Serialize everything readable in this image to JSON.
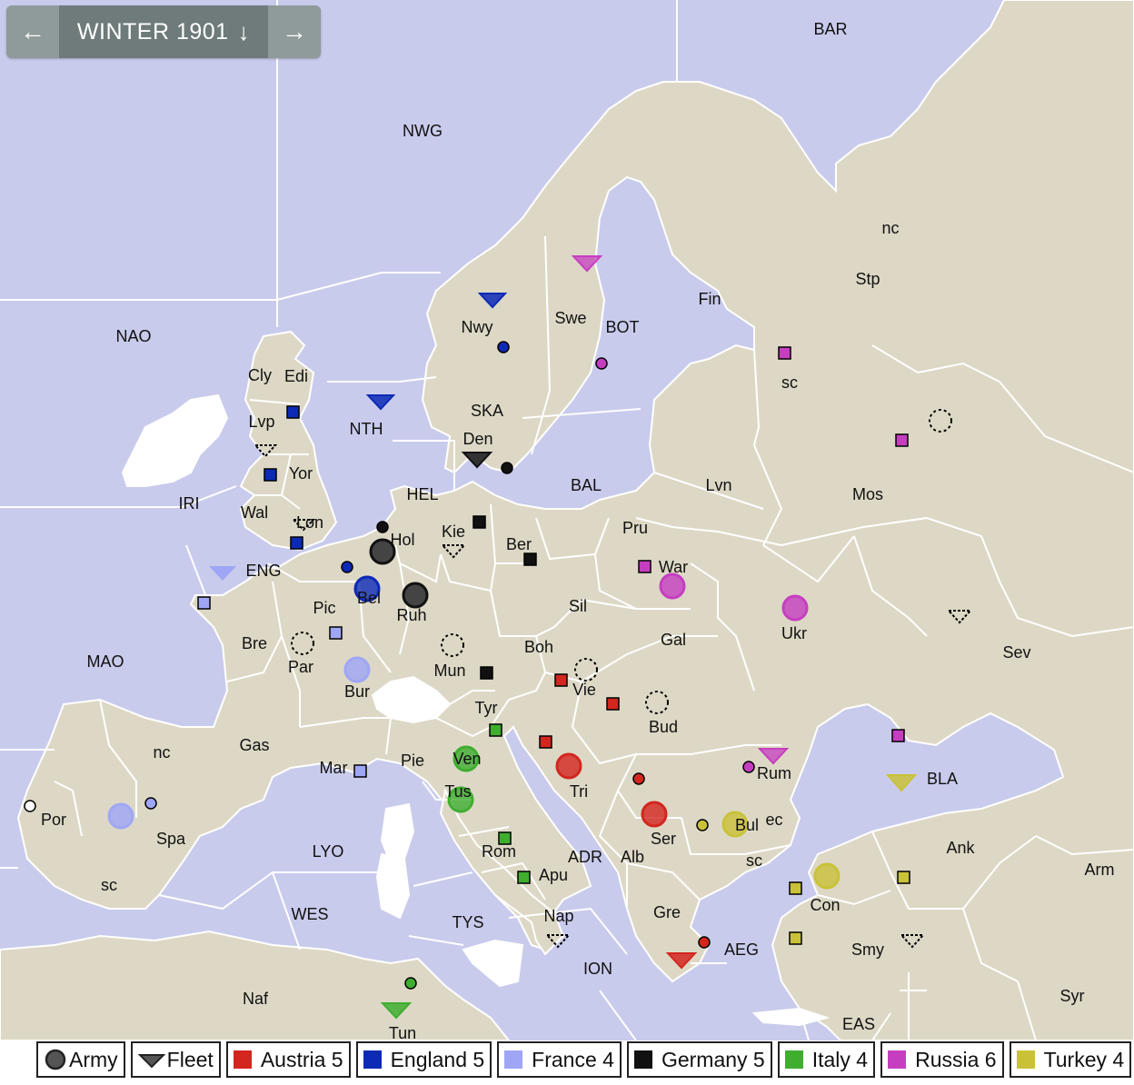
{
  "nav": {
    "prev_icon": "←",
    "phase_label": "WINTER 1901",
    "phase_icon": "↓",
    "next_icon": "→"
  },
  "colors": {
    "sea": "#c9cbec",
    "land": "#ddd8c5",
    "border": "#ffffff",
    "neutral": "#ffffff",
    "Austria": "#d3261f",
    "England": "#0c2ab6",
    "France": "#9fa6f5",
    "Germany": "#111111",
    "Italy": "#3fae2f",
    "Russia": "#c63ec0",
    "Turkey": "#c9c239"
  },
  "legend": [
    {
      "label": "Army",
      "icon": "army-icon"
    },
    {
      "label": "Fleet",
      "icon": "fleet-icon"
    },
    {
      "label": "Austria 5",
      "power": "Austria"
    },
    {
      "label": "England 5",
      "power": "England"
    },
    {
      "label": "France 4",
      "power": "France"
    },
    {
      "label": "Germany 5",
      "power": "Germany"
    },
    {
      "label": "Italy 4",
      "power": "Italy"
    },
    {
      "label": "Russia 6",
      "power": "Russia"
    },
    {
      "label": "Turkey 4",
      "power": "Turkey"
    }
  ],
  "provinces": [
    "BAR",
    "NWG",
    "NAO",
    "Cly",
    "Edi",
    "Lvp",
    "Yor",
    "Wal",
    "Lon",
    "IRI",
    "ENG",
    "MAO",
    "Bre",
    "Pic",
    "Par",
    "Bur",
    "Gas",
    "Mar",
    "nc",
    "sc",
    "Por",
    "Spa",
    "LYO",
    "WES",
    "Naf",
    "Tun",
    "NTH",
    "HEL",
    "SKA",
    "Den",
    "Nwy",
    "Swe",
    "BOT",
    "Fin",
    "Stp",
    "nc",
    "sc",
    "BAL",
    "Hol",
    "Bel",
    "Kie",
    "Ruh",
    "Ber",
    "Pru",
    "Lvn",
    "Mos",
    "War",
    "Sil",
    "Mun",
    "Boh",
    "Gal",
    "Ukr",
    "Sev",
    "Tyr",
    "Vie",
    "Bud",
    "Pie",
    "Ven",
    "Tus",
    "Rom",
    "Apu",
    "Nap",
    "TYS",
    "ION",
    "ADR",
    "Alb",
    "Tri",
    "Ser",
    "Rum",
    "Bul",
    "ec",
    "sc",
    "BLA",
    "Con",
    "Ank",
    "Arm",
    "Smy",
    "Syr",
    "Gre",
    "AEG",
    "EAS"
  ],
  "units": [
    {
      "power": "England",
      "type": "Fleet",
      "province": "Nwy"
    },
    {
      "power": "England",
      "type": "Fleet",
      "province": "NTH"
    },
    {
      "power": "England",
      "type": "Army",
      "province": "Bel"
    },
    {
      "power": "France",
      "type": "Fleet",
      "province": "ENG"
    },
    {
      "power": "France",
      "type": "Army",
      "province": "Bur"
    },
    {
      "power": "France",
      "type": "Army",
      "province": "Spa"
    },
    {
      "power": "Germany",
      "type": "Fleet",
      "province": "Den"
    },
    {
      "power": "Germany",
      "type": "Army",
      "province": "Hol"
    },
    {
      "power": "Germany",
      "type": "Army",
      "province": "Ruh"
    },
    {
      "power": "Russia",
      "type": "Fleet",
      "province": "Swe"
    },
    {
      "power": "Russia",
      "type": "Army",
      "province": "War"
    },
    {
      "power": "Russia",
      "type": "Army",
      "province": "Ukr"
    },
    {
      "power": "Russia",
      "type": "Fleet",
      "province": "Rum"
    },
    {
      "power": "Austria",
      "type": "Army",
      "province": "Tri"
    },
    {
      "power": "Austria",
      "type": "Army",
      "province": "Ser"
    },
    {
      "power": "Austria",
      "type": "Fleet",
      "province": "AEG"
    },
    {
      "power": "Italy",
      "type": "Army",
      "province": "Ven"
    },
    {
      "power": "Italy",
      "type": "Army",
      "province": "Tus"
    },
    {
      "power": "Italy",
      "type": "Fleet",
      "province": "Tun"
    },
    {
      "power": "Turkey",
      "type": "Fleet",
      "province": "BLA"
    },
    {
      "power": "Turkey",
      "type": "Army",
      "province": "Bul"
    },
    {
      "power": "Turkey",
      "type": "Army",
      "province": "Con"
    }
  ]
}
